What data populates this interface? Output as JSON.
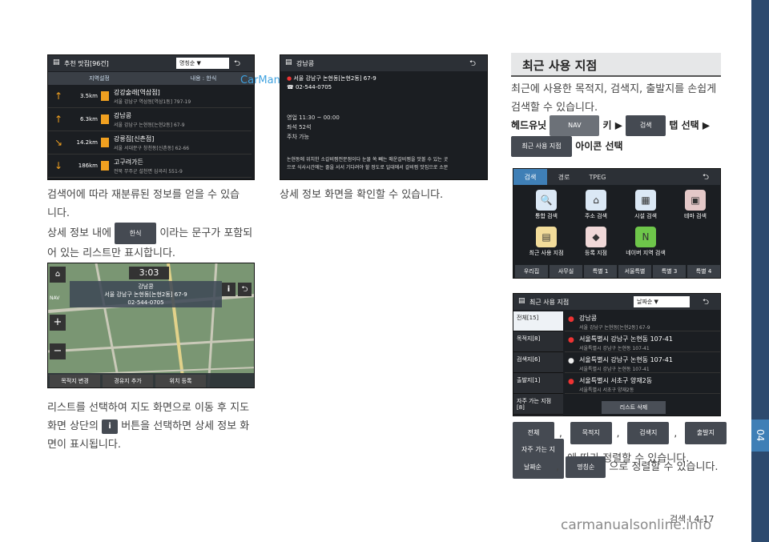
{
  "footer": {
    "page_label": "검색 I 4-17"
  },
  "side_tab": {
    "number": "04"
  },
  "watermark": {
    "top": "CarManuals2.com",
    "bottom": "carmanualsonline.info"
  },
  "left_col": {
    "shot1": {
      "title": "추천 맛집[96건]",
      "sort": "명칭순",
      "btn_area": "지역설정",
      "btn_content": "내용 : 한식",
      "items": [
        {
          "dist": "3.5km",
          "name": "강강술래[역삼점]",
          "addr": "서울 강남구 역삼동[역삼1동] 797-19"
        },
        {
          "dist": "6.3km",
          "name": "강남콩",
          "addr": "서울 강남구 논현동[논현2동] 67-9"
        },
        {
          "dist": "14.2km",
          "name": "강릉집[신촌점]",
          "addr": "서울 서대문구 창천동[신촌동] 62-66"
        },
        {
          "dist": "186km",
          "name": "고구려가든",
          "addr": "전북 무주군 설천면 심곡리 551-9"
        }
      ]
    },
    "para1_1": "검색어에 따라 재분류된 정보를 얻을 수 있습",
    "para1_2": "니다.",
    "para2_1": "상세 정보 내에",
    "chip_hansik": "한식",
    "para2_2": "이라는 문구가 포함되",
    "para2_3": "어 있는 리스트만 표시합니다.",
    "map": {
      "time": "3:03",
      "place": "강남콩",
      "addr": "서울 강남구 논현동[논현2동] 67-9",
      "phone": "02-544-0705",
      "btn1": "목적지 변경",
      "btn2": "경유지 추가",
      "btn3": "위치 등록",
      "nav": "NAV"
    },
    "para3_1": "리스트를 선택하여 지도 화면으로 이동 후 지도",
    "para3_2": "화면 상단의",
    "para3_3": "버튼을 선택하면 상세 정보 화",
    "para3_4": "면이 표시됩니다."
  },
  "mid_col": {
    "shot": {
      "title": "강남콩",
      "addr": "서울 강남구 논현동[논현2동] 67-9",
      "phone": "02-544-0705",
      "hours": "영업 11:30 ~ 00:00",
      "seats": "좌석 52석",
      "parking": "주차 가능",
      "desc1": "논현동에 위치한 소갈비찜전문점이다 눈물 쏙 빼는 매운갈비찜을 맛볼 수 있는 곳",
      "desc2": "으로 식사시간에는 줄을 서서 기다려야 할 정도로 일대에서 갈비찜 맛집으로 소문"
    },
    "para": "상세 정보 화면을 확인할 수 있습니다."
  },
  "right_col": {
    "heading": "최근 사용 지점",
    "para1": "최근에 사용한 목적지, 검색지, 출발지를 손쉽게",
    "para2": "검색할 수 있습니다.",
    "inst_a": "헤드유닛",
    "chip_nav": "NAV",
    "inst_b": "키 ▶",
    "chip_search": "검색",
    "inst_c": "탭 선택 ▶",
    "chip_recent": "최근 사용 지점",
    "inst_d": "아이콘 선택",
    "menu_shot": {
      "tabs": [
        "검색",
        "경로",
        "TPEG"
      ],
      "icons": [
        "통합 검색",
        "주소 검색",
        "시설 검색",
        "테마 검색",
        "최근 사용 지점",
        "등록 지점",
        "네이버 지역 검색"
      ],
      "bottom": [
        "우리집",
        "사무실",
        "특별 1",
        "서울특별",
        "특별 3",
        "특별 4"
      ]
    },
    "recent_shot": {
      "title": "최근 사용 지점",
      "sort": "날짜순",
      "filters": [
        "전체[15]",
        "목적지[8]",
        "검색지[6]",
        "출발지[1]",
        "자주 가는 지점 [8]"
      ],
      "items": [
        {
          "name": "강남콩",
          "addr": "서울 강남구 논현동[논현2동] 67-9"
        },
        {
          "name": "서울특별시 강남구 논현동 107-41",
          "addr": "서울특별시 강남구 논현동 107-41"
        },
        {
          "name": "서울특별시 강남구 논현동 107-41",
          "addr": "서울특별시 강남구 논현동 107-41"
        },
        {
          "name": "서울특별시 서초구 양재2동",
          "addr": "서울특별시 서초구 양재2동"
        }
      ],
      "delete_btn": "리스트 삭제"
    },
    "chips_row1": [
      "전체",
      "목적지",
      "검색지",
      "출발지"
    ],
    "chip_frequent": "자주 가는 지점",
    "sort_text": "에 따라 정렬할 수 있습니다.",
    "chip_date": "날짜순",
    "chip_name": "명칭순",
    "sort_text2": "으로 정렬할 수 있습니다.",
    "comma": ","
  }
}
